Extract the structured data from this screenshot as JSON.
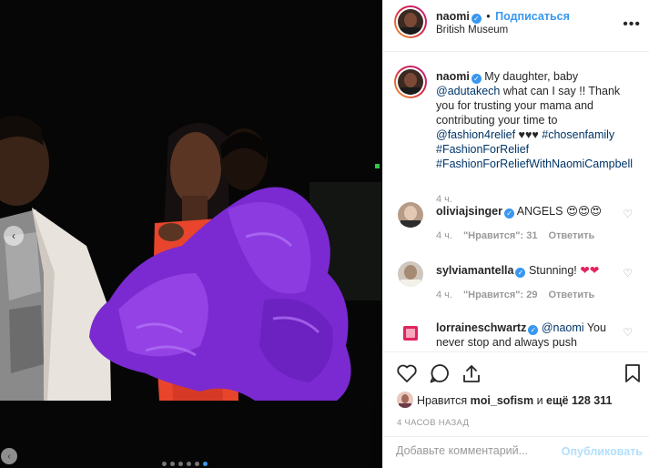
{
  "header": {
    "username": "naomi",
    "follow_label": "Подписаться",
    "separator": "•",
    "location": "British Museum",
    "more_label": "•••"
  },
  "photo": {
    "prev_label": "‹",
    "next_label": "‹",
    "dots_count": 6,
    "active_dot": 5
  },
  "caption": {
    "username": "naomi",
    "text_1": " My daughter, baby ",
    "mention": "@adutakech",
    "text_2": " what can I say !! Thank you for trusting your mama and contributing your time to ",
    "tag_1": "@fashion4relief",
    "hearts": " ♥♥♥ ",
    "tag_2": "#chosenfamily",
    "tag_3": "#FashionForRelief",
    "tag_4": "#FashionForReliefWithNaomiCampbell",
    "time": "4 ч."
  },
  "comments": [
    {
      "username": "oliviajsinger",
      "text": " ANGELS ",
      "emoji": "😍😍😍",
      "time": "4 ч.",
      "likes": "\"Нравится\": 31",
      "reply": "Ответить"
    },
    {
      "username": "sylviamantella",
      "text": " Stunning! ",
      "emoji": "❤❤",
      "time": "4 ч.",
      "likes": "\"Нравится\": 29",
      "reply": "Ответить"
    },
    {
      "username": "lorraineschwartz",
      "mention": "@naomi",
      "text": " You never stop and always push"
    }
  ],
  "likes": {
    "prefix": "Нравится ",
    "user": "moi_sofism",
    "middle": " и ",
    "others": "ещё 128 311"
  },
  "time_ago": "4 ЧАСОВ НАЗАД",
  "add_comment": {
    "placeholder": "Добавьте комментарий...",
    "publish_label": "Опубликовать"
  },
  "colors": {
    "accent": "#3897f0",
    "link": "#003569",
    "heart_red": "#ed4956"
  }
}
